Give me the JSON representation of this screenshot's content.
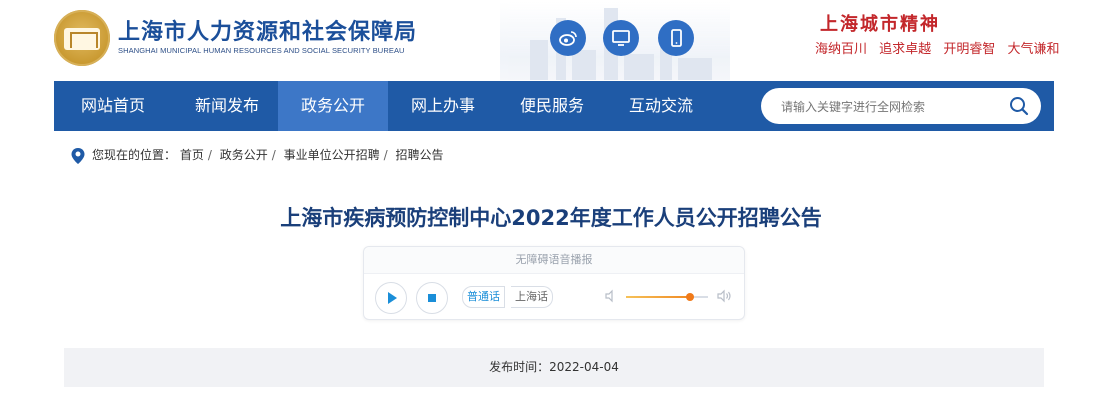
{
  "header": {
    "title_cn": "上海市人力资源和社会保障局",
    "title_en": "SHANGHAI MUNICIPAL HUMAN RESOURCES AND SOCIAL SECURITY BUREAU",
    "icons": [
      "weibo-icon",
      "monitor-icon",
      "mobile-icon"
    ],
    "spirit_title": "上海城市精神",
    "spirit_words": [
      "海纳百川",
      "追求卓越",
      "开明睿智",
      "大气谦和"
    ]
  },
  "nav": {
    "items": [
      "网站首页",
      "新闻发布",
      "政务公开",
      "网上办事",
      "便民服务",
      "互动交流"
    ],
    "active": "政务公开",
    "search_placeholder": "请输入关键字进行全网检索"
  },
  "breadcrumb": {
    "label": "您现在的位置：",
    "items": [
      "首页",
      "政务公开",
      "事业单位公开招聘",
      "招聘公告"
    ]
  },
  "article": {
    "title": "上海市疾病预防控制中心2022年度工作人员公开招聘公告"
  },
  "player": {
    "header": "无障碍语音播报",
    "lang_mandarin": "普通话",
    "lang_shanghai": "上海话",
    "volume_level": 0.78
  },
  "publish": {
    "label": "发布时间：",
    "date": "2022-04-04"
  },
  "colors": {
    "nav_bg": "#1f5aa6",
    "nav_active": "#3d77c7",
    "title": "#1a3f7a",
    "spirit": "#c3272b"
  }
}
